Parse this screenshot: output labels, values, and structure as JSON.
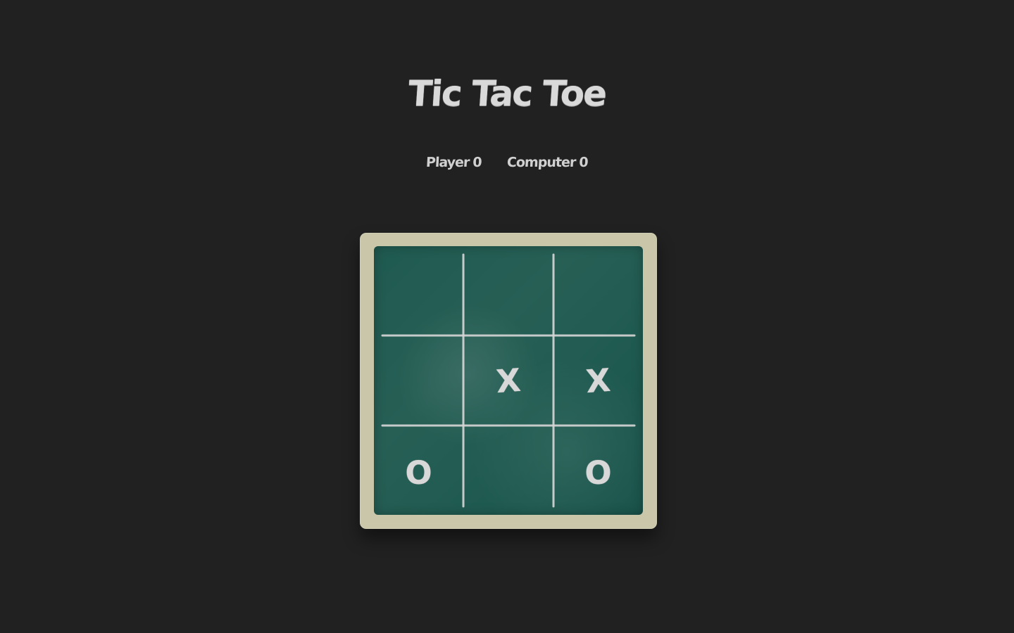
{
  "game": {
    "title": "Tic Tac Toe",
    "scores": [
      {
        "label": "Player",
        "value": "0"
      },
      {
        "label": "Computer",
        "value": "0"
      }
    ],
    "board": [
      [
        "",
        "",
        ""
      ],
      [
        "",
        "X",
        "X"
      ],
      [
        "O",
        "",
        "O"
      ]
    ]
  },
  "colors": {
    "background": "#212121",
    "board_frame": "#c9c6a9",
    "board_surface": "#1f5a50",
    "chalk": "#d8d8d8"
  }
}
